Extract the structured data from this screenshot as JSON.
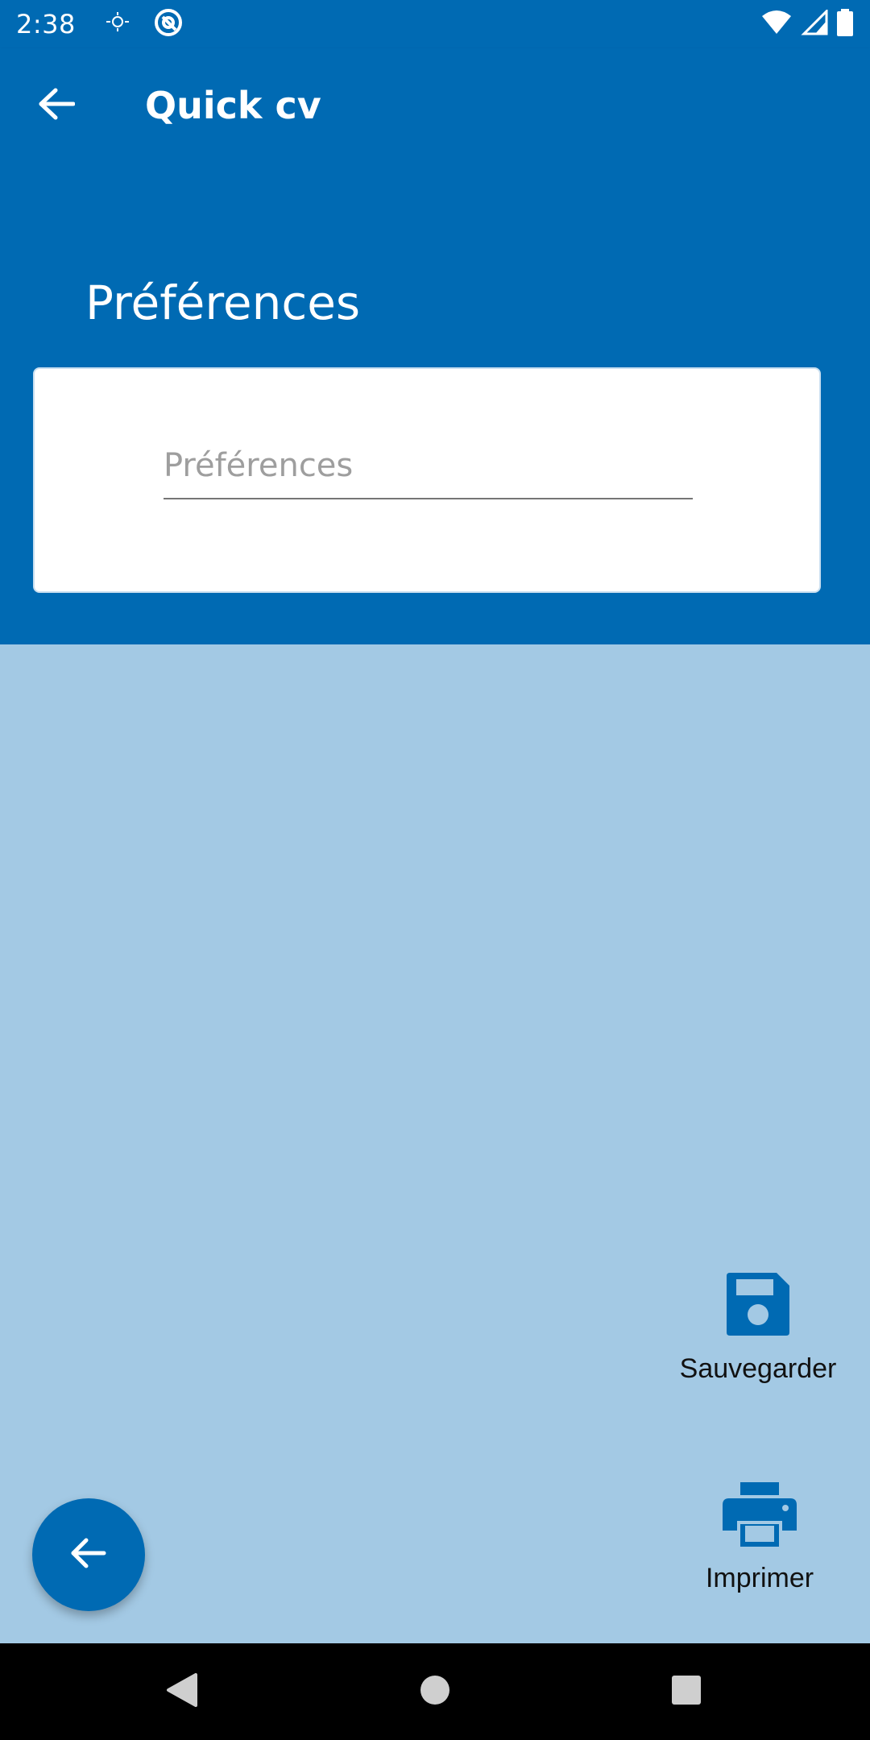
{
  "status_bar": {
    "time": "2:38",
    "icons_left": [
      "weather-sun-icon",
      "at-sign-icon"
    ],
    "icons_right": [
      "wifi-icon",
      "signal-icon",
      "battery-icon"
    ]
  },
  "app_bar": {
    "title": "Quick cv",
    "back_icon": "arrow-left-icon"
  },
  "section": {
    "title": "Préférences"
  },
  "preferences_field": {
    "value": "",
    "placeholder": "Préférences"
  },
  "actions": {
    "save_label": "Sauvegarder",
    "print_label": "Imprimer"
  },
  "fab": {
    "icon": "arrow-left-icon"
  },
  "colors": {
    "primary": "#006ab3",
    "background": "#a3c9e4",
    "surface": "#ffffff"
  }
}
